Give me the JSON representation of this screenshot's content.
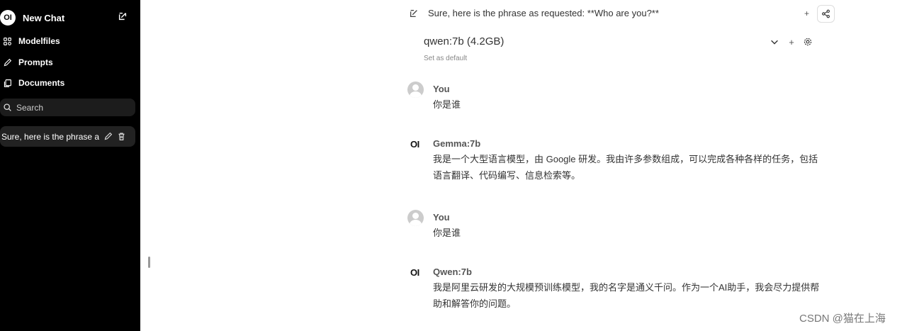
{
  "sidebar": {
    "logo_text": "OI",
    "new_chat_label": "New Chat",
    "items": [
      {
        "label": "Modelfiles"
      },
      {
        "label": "Prompts"
      },
      {
        "label": "Documents"
      }
    ],
    "search_placeholder": "Search",
    "chats": [
      {
        "title": "Sure, here is the phrase a"
      }
    ]
  },
  "header": {
    "title": "Sure, here is the phrase as requested: **Who are you?**",
    "plus_label": "+"
  },
  "model_selector": {
    "selected": "qwen:7b (4.2GB)",
    "plus_label": "+",
    "set_default_label": "Set as default"
  },
  "messages": [
    {
      "role": "user",
      "name": "You",
      "text": "你是谁"
    },
    {
      "role": "assistant",
      "avatar_text": "OI",
      "name": "Gemma:7b",
      "lines": [
        "我是一个大型语言模型，由 Google 研发。我由许多参数组成，可以完成各种各样的任务，包括",
        "语言翻译、代码编写、信息检索等。"
      ]
    },
    {
      "role": "user",
      "name": "You",
      "text": "你是谁"
    },
    {
      "role": "assistant",
      "avatar_text": "OI",
      "name": "Qwen:7b",
      "lines": [
        "我是阿里云研发的大规模预训练模型，我的名字是通义千问。作为一个AI助手，我会尽力提供帮",
        "助和解答你的问题。"
      ]
    }
  ],
  "watermark": "CSDN @猫在上海"
}
